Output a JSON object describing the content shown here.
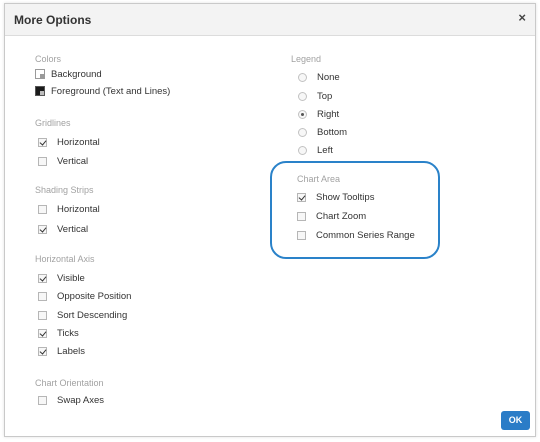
{
  "dialog": {
    "title": "More Options",
    "close_symbol": "×"
  },
  "colors": {
    "title": "Colors",
    "background_label": "Background",
    "foreground_label": "Foreground (Text and Lines)"
  },
  "gridlines": {
    "title": "Gridlines",
    "horizontal": {
      "label": "Horizontal",
      "checked": true
    },
    "vertical": {
      "label": "Vertical",
      "checked": false
    }
  },
  "shading_strips": {
    "title": "Shading Strips",
    "horizontal": {
      "label": "Horizontal",
      "checked": false
    },
    "vertical": {
      "label": "Vertical",
      "checked": true
    }
  },
  "horizontal_axis": {
    "title": "Horizontal Axis",
    "visible": {
      "label": "Visible",
      "checked": true
    },
    "opposite_position": {
      "label": "Opposite Position",
      "checked": false
    },
    "sort_descending": {
      "label": "Sort Descending",
      "checked": false
    },
    "ticks": {
      "label": "Ticks",
      "checked": true
    },
    "labels": {
      "label": "Labels",
      "checked": true
    }
  },
  "chart_orientation": {
    "title": "Chart Orientation",
    "swap_axes": {
      "label": "Swap Axes",
      "checked": false
    }
  },
  "legend": {
    "title": "Legend",
    "options": [
      "None",
      "Top",
      "Right",
      "Bottom",
      "Left"
    ],
    "selected": "Right"
  },
  "chart_area": {
    "title": "Chart Area",
    "show_tooltips": {
      "label": "Show Tooltips",
      "checked": true
    },
    "chart_zoom": {
      "label": "Chart Zoom",
      "checked": false
    },
    "common_series_range": {
      "label": "Common Series Range",
      "checked": false
    }
  },
  "footer": {
    "ok_label": "OK"
  },
  "theme": {
    "accent": "#2a7cc7",
    "highlight_ring": "#2a82c9"
  }
}
